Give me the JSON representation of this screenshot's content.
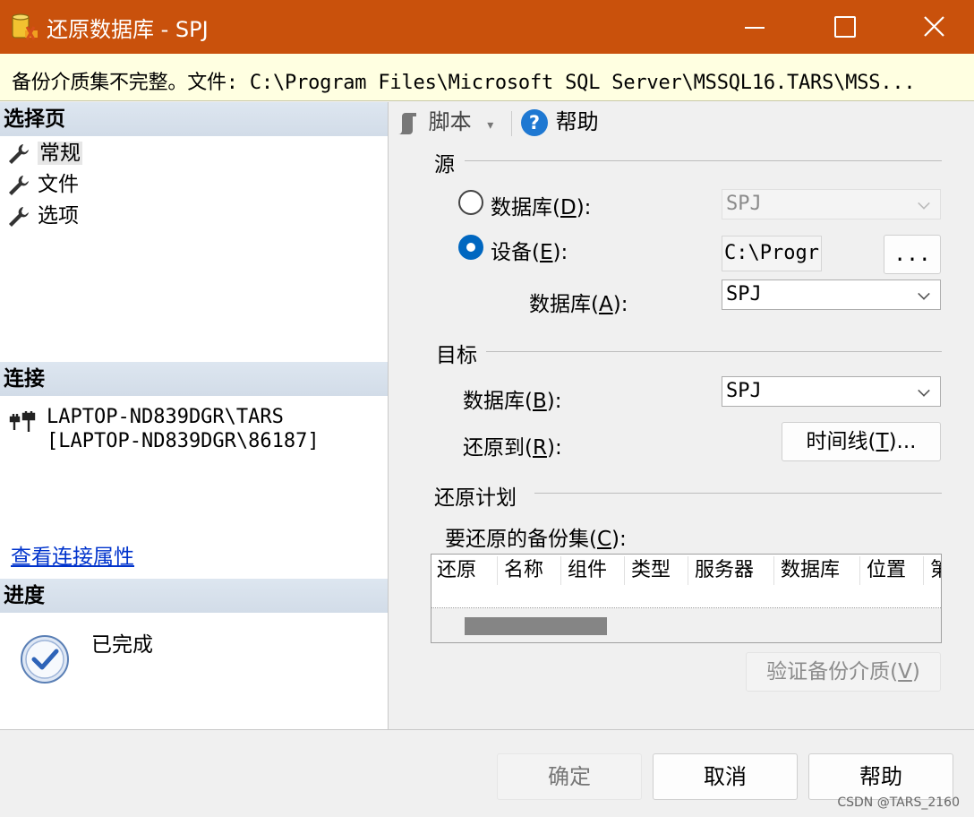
{
  "window": {
    "title": "还原数据库 - SPJ",
    "minimize": "—",
    "maximize": "☐",
    "close": "✕"
  },
  "warning": {
    "text": "备份介质集不完整。文件: C:\\Program Files\\Microsoft SQL Server\\MSSQL16.TARS\\MSS..."
  },
  "left": {
    "select_page_header": "选择页",
    "pages": [
      {
        "label": "常规",
        "icon": "wrench-icon"
      },
      {
        "label": "文件",
        "icon": "wrench-icon"
      },
      {
        "label": "选项",
        "icon": "wrench-icon"
      }
    ],
    "connection_header": "连接",
    "connection_line1": "LAPTOP-ND839DGR\\TARS",
    "connection_line2": "[LAPTOP-ND839DGR\\86187]",
    "connection_link": "查看连接属性",
    "progress_header": "进度",
    "progress_status": "已完成"
  },
  "toolbar": {
    "script_label": "脚本",
    "help_label": "帮助"
  },
  "source": {
    "group_title": "源",
    "database_radio_label": "数据库(",
    "database_radio_key": "D",
    "database_radio_suffix": "):",
    "database_value": "SPJ",
    "device_radio_label": "设备(",
    "device_radio_key": "E",
    "device_radio_suffix": "):",
    "device_value": "C:\\Progr",
    "browse_label": "...",
    "device_db_label": "数据库(",
    "device_db_key": "A",
    "device_db_suffix": "):",
    "device_db_value": "SPJ",
    "selected": "device"
  },
  "target": {
    "group_title": "目标",
    "db_label": "数据库(",
    "db_key": "B",
    "db_suffix": "):",
    "db_value": "SPJ",
    "restore_to_label": "还原到(",
    "restore_to_key": "R",
    "restore_to_suffix": "):",
    "timeline_label": "时间线(",
    "timeline_key": "T",
    "timeline_suffix": ")..."
  },
  "plan": {
    "group_title": "还原计划",
    "backupsets_label": "要还原的备份集(",
    "backupsets_key": "C",
    "backupsets_suffix": "):",
    "columns": [
      "还原",
      "名称",
      "组件",
      "类型",
      "服务器",
      "数据库",
      "位置",
      "第"
    ],
    "verify_label": "验证备份介质(",
    "verify_key": "V",
    "verify_suffix": ")"
  },
  "buttons": {
    "ok": "确定",
    "cancel": "取消",
    "help": "帮助"
  },
  "watermark": "CSDN @TARS_2160",
  "colors": {
    "titlebar": "#c9510c",
    "warning_bg": "#ffffe1",
    "accent": "#0067c0",
    "link": "#0033cc"
  }
}
